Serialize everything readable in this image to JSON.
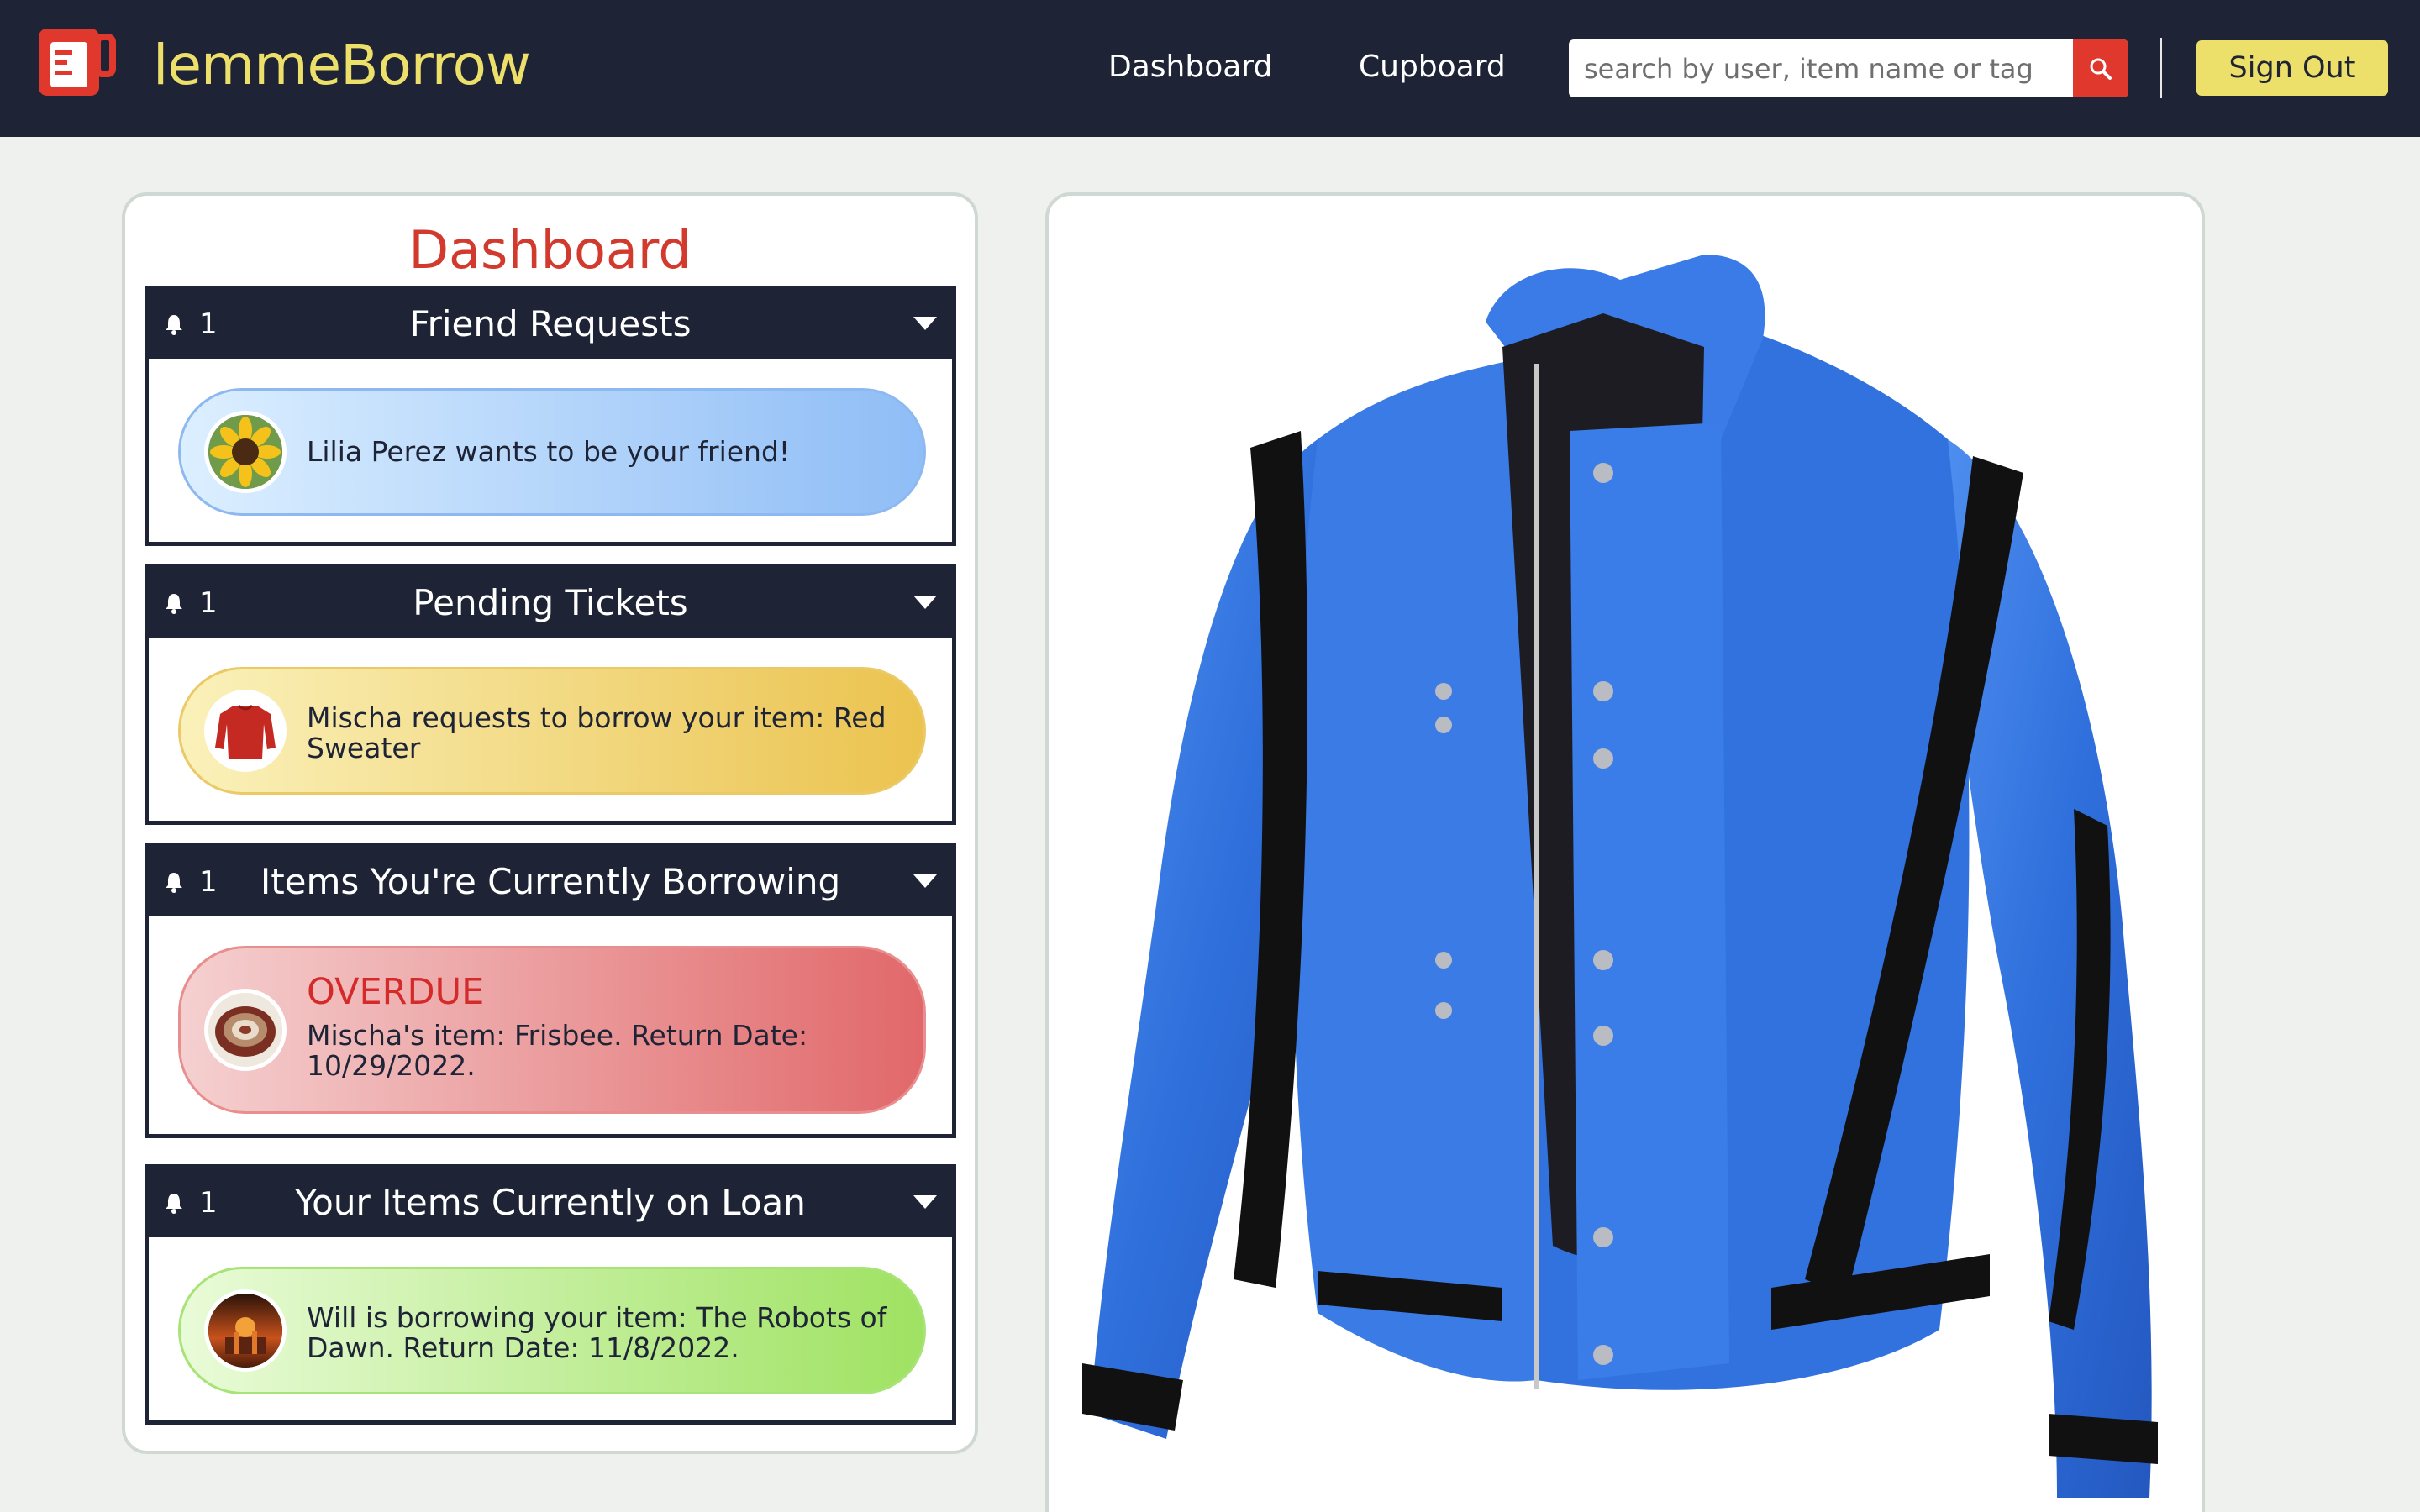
{
  "brand": {
    "name": "lemmeBorrow",
    "logo_icon": "blender-cup-icon",
    "accent": "#ece06a",
    "logo_color": "#e0382d"
  },
  "nav": {
    "links": [
      "Dashboard",
      "Cupboard"
    ],
    "search": {
      "placeholder": "search by user, item name or tag",
      "value": "",
      "button_icon": "search-icon"
    },
    "sign_out": "Sign Out"
  },
  "dashboard": {
    "title": "Dashboard",
    "sections": [
      {
        "title": "Friend Requests",
        "count": "1",
        "cards": [
          {
            "text": "Lilia Perez wants to be your friend!",
            "avatar": "sunflower-avatar"
          }
        ]
      },
      {
        "title": "Pending Tickets",
        "count": "1",
        "cards": [
          {
            "text": "Mischa requests to borrow your item: Red Sweater",
            "avatar": "red-sweater-avatar"
          }
        ]
      },
      {
        "title": "Items You're Currently Borrowing",
        "count": "1",
        "cards": [
          {
            "status": "OVERDUE",
            "text": "Mischa's item: Frisbee. Return Date: 10/29/2022.",
            "avatar": "frisbee-avatar"
          }
        ]
      },
      {
        "title": "Your Items Currently on Loan",
        "count": "1",
        "cards": [
          {
            "text": "Will is borrowing your item: The Robots of Dawn. Return Date: 11/8/2022.",
            "avatar": "book-cover-avatar"
          }
        ]
      }
    ]
  },
  "product": {
    "image": "blue-leather-jacket-image"
  },
  "colors": {
    "navbar": "#1e2435",
    "title_red": "#d23a2e",
    "overdue_red": "#d52a2a"
  }
}
